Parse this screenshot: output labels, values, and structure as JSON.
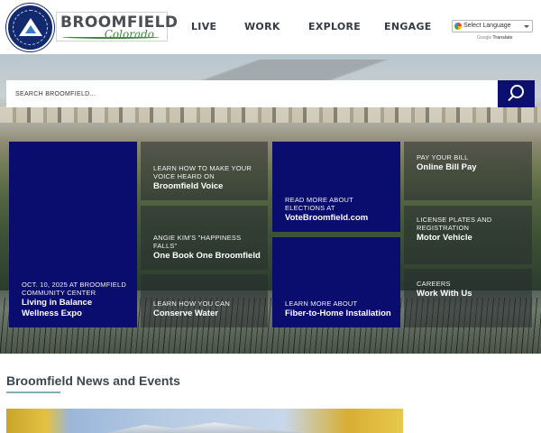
{
  "header": {
    "brand": {
      "name": "BROOMFIELD",
      "state": "Colorado",
      "seal_text": "City and County of Broomfield Colorado"
    },
    "nav": [
      {
        "label": "LIVE"
      },
      {
        "label": "WORK"
      },
      {
        "label": "EXPLORE"
      },
      {
        "label": "ENGAGE"
      }
    ],
    "translate": {
      "label": "Select Language",
      "powered_by": "Google",
      "powered_service": "Translate"
    }
  },
  "hero": {
    "search": {
      "placeholder": "SEARCH BROOMFIELD..."
    }
  },
  "tiles": [
    {
      "id": "wellness-expo",
      "kicker": "OCT. 10, 2025 AT BROOMFIELD COMMUNITY CENTER",
      "title": "Living in Balance Wellness Expo",
      "style": "navy"
    },
    {
      "id": "broomfield-voice",
      "kicker": "LEARN HOW TO MAKE YOUR VOICE HEARD ON",
      "title": "Broomfield Voice",
      "style": "photo"
    },
    {
      "id": "one-book",
      "kicker": "ANGIE KIM'S \"HAPPINESS FALLS\"",
      "title": "One Book One Broomfield",
      "style": "photo"
    },
    {
      "id": "conserve-water",
      "kicker": "LEARN HOW YOU CAN",
      "title": "Conserve Water",
      "style": "photo"
    },
    {
      "id": "vote-broomfield",
      "kicker": "READ MORE ABOUT ELECTIONS AT",
      "title": "VoteBroomfield.com",
      "style": "navy"
    },
    {
      "id": "fiber-to-home",
      "kicker": "LEARN MORE ABOUT",
      "title": "Fiber-to-Home Installation",
      "style": "navy"
    },
    {
      "id": "online-bill-pay",
      "kicker": "PAY YOUR BILL",
      "title": "Online Bill Pay",
      "style": "photo"
    },
    {
      "id": "motor-vehicle",
      "kicker": "LICENSE PLATES AND REGISTRATION",
      "title": "Motor Vehicle",
      "style": "photo"
    },
    {
      "id": "careers",
      "kicker": "CAREERS",
      "title": "Work With Us",
      "style": "photo"
    }
  ],
  "news": {
    "heading": "Broomfield News and Events"
  },
  "colors": {
    "navy": "#0b0d6e",
    "brand_green": "#3f8a3a",
    "heading_text": "#3b4650",
    "underline": "#7fb0b8"
  }
}
